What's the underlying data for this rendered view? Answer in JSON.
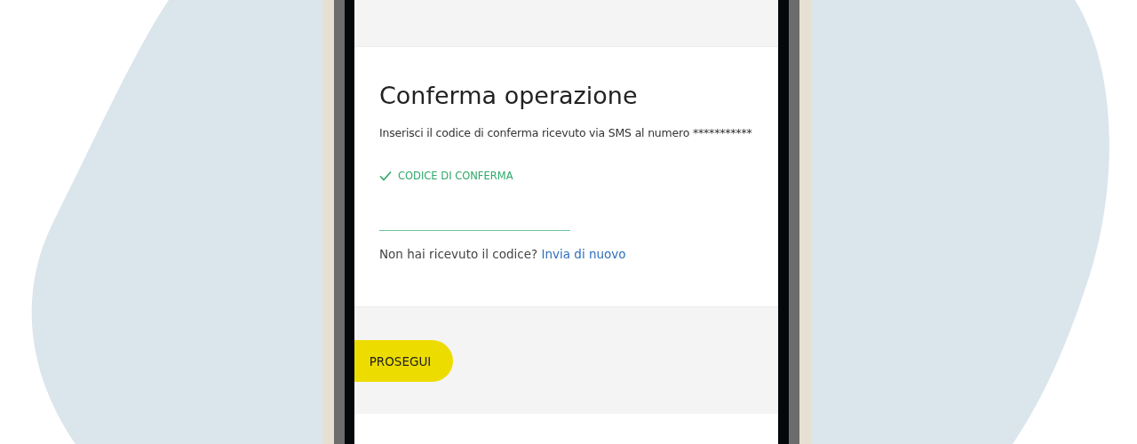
{
  "title": "Conferma operazione",
  "instruction": "Inserisci il codice di conferma ricevuto via SMS al numero ***********",
  "code_field": {
    "label": "CODICE DI CONFERMA",
    "valid": true
  },
  "resend": {
    "text": "Non hai ricevuto il codice?",
    "link": "Invia di nuovo"
  },
  "button": "PROSEGUI"
}
